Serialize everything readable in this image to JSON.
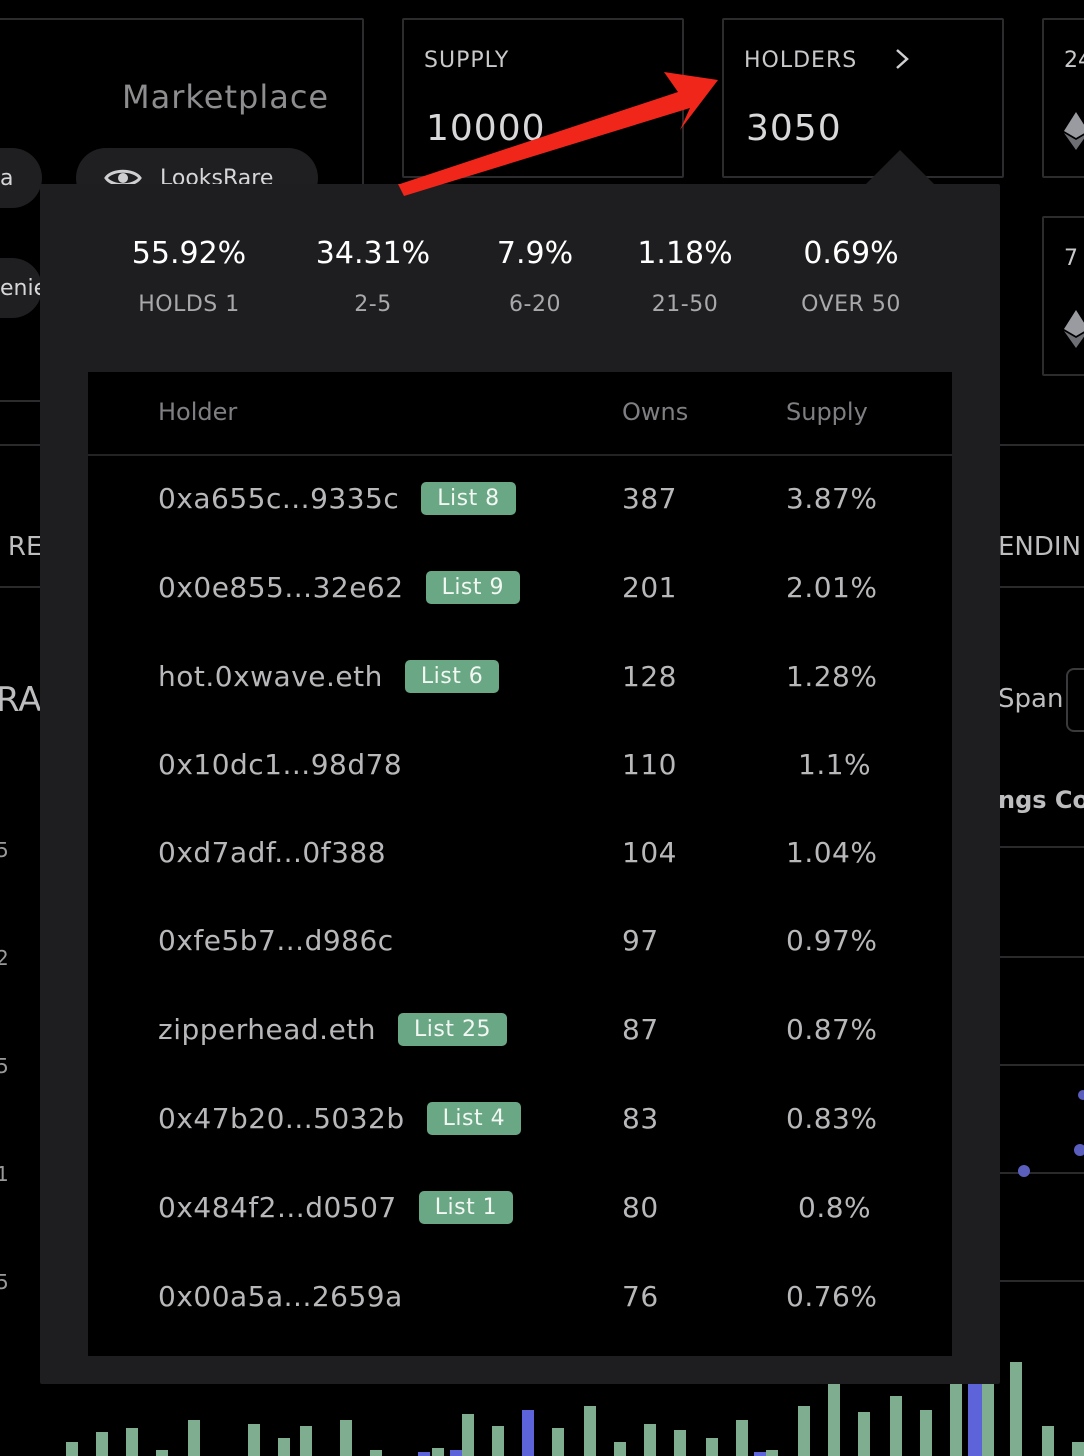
{
  "page": {
    "marketplace_label": "Marketplace",
    "pill_left_text": "a",
    "pill_looksrare": "LooksRare",
    "pill_left2_text": "enie",
    "frag_left_tab": "I RE",
    "frag_right_tab": "ENDIN",
    "frag_left_big": "RA",
    "frag_span": "Span",
    "frag_right_col": "ngs Co",
    "frag_card3": "24",
    "frag_card3b": "7",
    "axis_ticks": [
      "5",
      "2",
      "5",
      "1",
      "5"
    ]
  },
  "stats": {
    "supply_label": "SUPPLY",
    "supply_value": "10000",
    "holders_label": "HOLDERS",
    "holders_value": "3050",
    "holders_chevron": "chevron-right-icon"
  },
  "distribution": [
    {
      "value": "55.92%",
      "label": "HOLDS 1"
    },
    {
      "value": "34.31%",
      "label": "2-5"
    },
    {
      "value": "7.9%",
      "label": "6-20"
    },
    {
      "value": "1.18%",
      "label": "21-50"
    },
    {
      "value": "0.69%",
      "label": "OVER 50"
    }
  ],
  "table": {
    "headers": {
      "holder": "Holder",
      "owns": "Owns",
      "supply": "Supply"
    },
    "rows": [
      {
        "holder": "0xa655c...9335c",
        "badge": "List 8",
        "owns": "387",
        "supply": "3.87%"
      },
      {
        "holder": "0x0e855...32e62",
        "badge": "List 9",
        "owns": "201",
        "supply": "2.01%"
      },
      {
        "holder": "hot.0xwave.eth",
        "badge": "List 6",
        "owns": "128",
        "supply": "1.28%"
      },
      {
        "holder": "0x10dc1...98d78",
        "badge": "",
        "owns": "110",
        "supply": "1.1%"
      },
      {
        "holder": "0xd7adf...0f388",
        "badge": "",
        "owns": "104",
        "supply": "1.04%"
      },
      {
        "holder": "0xfe5b7...d986c",
        "badge": "",
        "owns": "97",
        "supply": "0.97%"
      },
      {
        "holder": "zipperhead.eth",
        "badge": "List 25",
        "owns": "87",
        "supply": "0.87%"
      },
      {
        "holder": "0x47b20...5032b",
        "badge": "List 4",
        "owns": "83",
        "supply": "0.83%"
      },
      {
        "holder": "0x484f2...d0507",
        "badge": "List 1",
        "owns": "80",
        "supply": "0.8%"
      },
      {
        "holder": "0x00a5a...2659a",
        "badge": "",
        "owns": "76",
        "supply": "0.76%"
      }
    ]
  },
  "colors": {
    "badge_green": "#6aa785",
    "annotation_arrow": "#f0261b",
    "popup_bg": "#1e1e20",
    "table_bg": "#000000"
  }
}
